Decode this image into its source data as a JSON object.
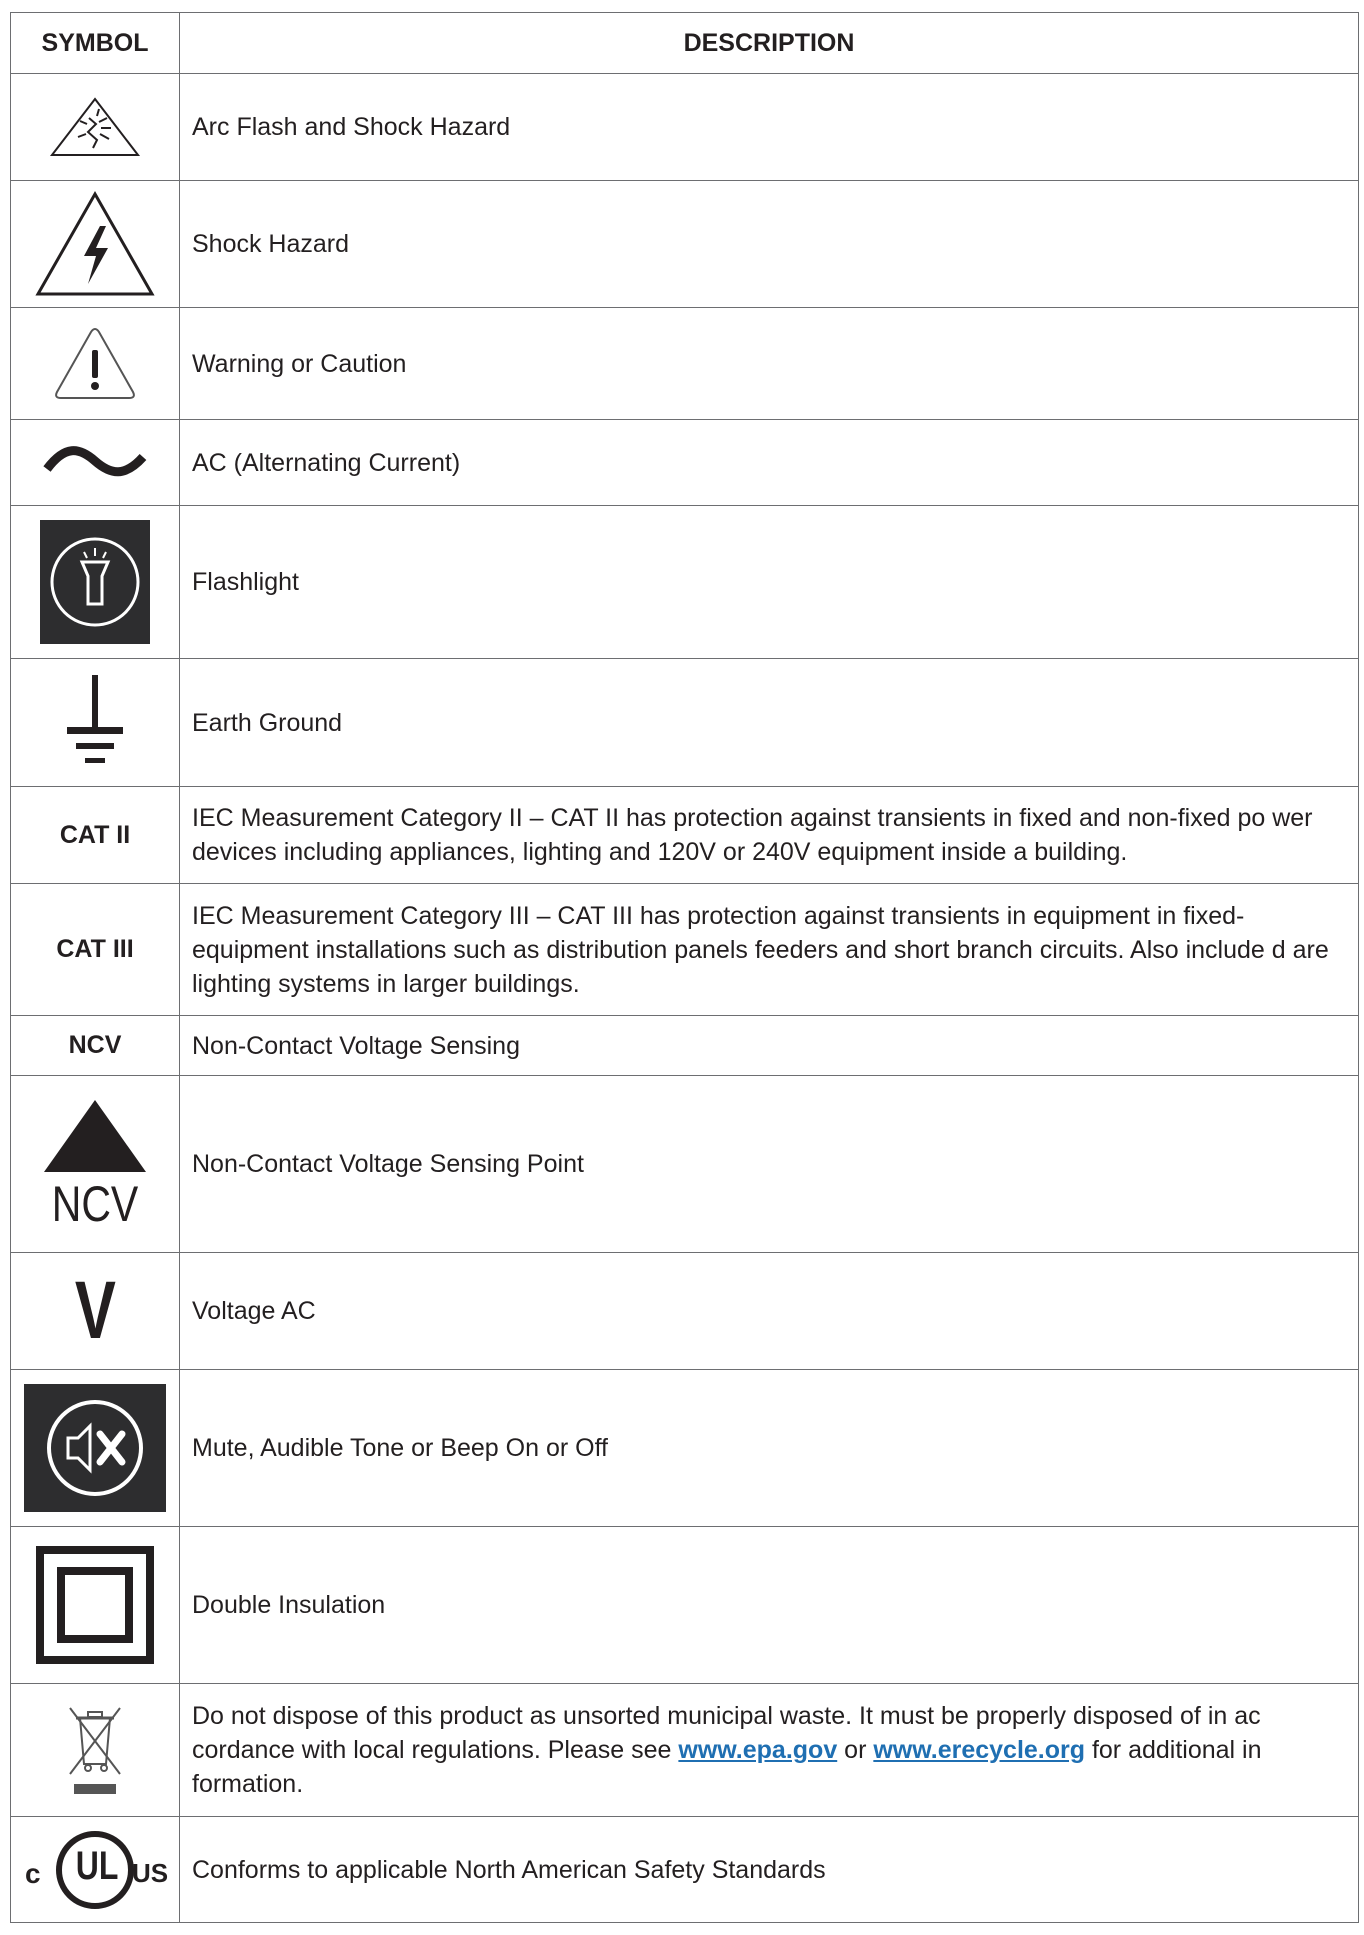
{
  "header": {
    "symbol": "SYMBOL",
    "description": "DESCRIPTION"
  },
  "rows": [
    {
      "icon": "arc-flash-icon",
      "description": "Arc Flash and Shock Hazard"
    },
    {
      "icon": "shock-hazard-icon",
      "description": "Shock Hazard"
    },
    {
      "icon": "warning-icon",
      "description": "Warning or Caution"
    },
    {
      "icon": "ac-wave-icon",
      "description": "AC (Alternating Current)"
    },
    {
      "icon": "flashlight-icon",
      "description": "Flashlight"
    },
    {
      "icon": "earth-ground-icon",
      "description": "Earth Ground"
    },
    {
      "symbol_text": "CAT II",
      "description": "IEC Measurement Category II – CAT II has protection against transients in fixed and non-fixed po wer devices including appliances, lighting and 120V or 240V equipment inside a building."
    },
    {
      "symbol_text": "CAT III",
      "description": "IEC Measurement Category III – CAT III has protection against transients in equipment in fixed-equipment installations such as distribution panels feeders and short branch circuits. Also include d are lighting systems in larger buildings."
    },
    {
      "symbol_text": "NCV",
      "description": "Non-Contact Voltage Sensing"
    },
    {
      "icon": "ncv-point-icon",
      "icon_text": "NCV",
      "description": "Non-Contact Voltage Sensing Point"
    },
    {
      "icon": "voltage-ac-icon",
      "icon_text": "V",
      "description": "Voltage AC"
    },
    {
      "icon": "mute-icon",
      "description": "Mute, Audible Tone or Beep On or Off"
    },
    {
      "icon": "double-insulation-icon",
      "description": "Double Insulation"
    },
    {
      "icon": "weee-bin-icon",
      "description_parts": {
        "before": "Do not dispose of this product as unsorted municipal waste. It must be properly disposed of in ac cordance with local regulations. Please see ",
        "link1": "www.epa.gov",
        "middle": " or ",
        "link2": "www.erecycle.org",
        "after": " for additional in formation."
      }
    },
    {
      "icon": "cul-us-icon",
      "icon_text_left": "c",
      "icon_text_center": "UL",
      "icon_text_right": "US",
      "description": "Conforms to applicable North American Safety Standards"
    }
  ],
  "colors": {
    "link": "#1f6fb2",
    "border": "#6d6e71",
    "text": "#231f20",
    "icon_dark": "#2d2d2f"
  }
}
